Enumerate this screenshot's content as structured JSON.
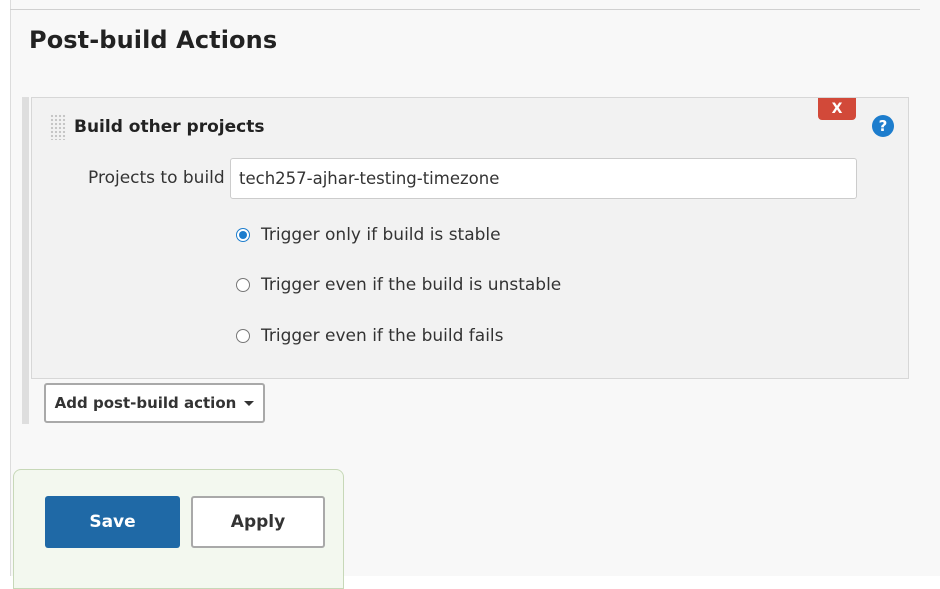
{
  "section": {
    "title": "Post-build Actions"
  },
  "panel": {
    "title": "Build other projects",
    "delete_label": "X",
    "help_label": "?",
    "projects_label": "Projects to build",
    "projects_value": "tech257-ajhar-testing-timezone",
    "options": [
      {
        "label": "Trigger only if build is stable",
        "selected": true
      },
      {
        "label": "Trigger even if the build is unstable",
        "selected": false
      },
      {
        "label": "Trigger even if the build fails",
        "selected": false
      }
    ]
  },
  "add_action": {
    "label": "Add post-build action"
  },
  "footer": {
    "save_label": "Save",
    "apply_label": "Apply"
  },
  "colors": {
    "primary": "#1f69a6",
    "danger": "#d24939",
    "help": "#1d7dcd"
  }
}
